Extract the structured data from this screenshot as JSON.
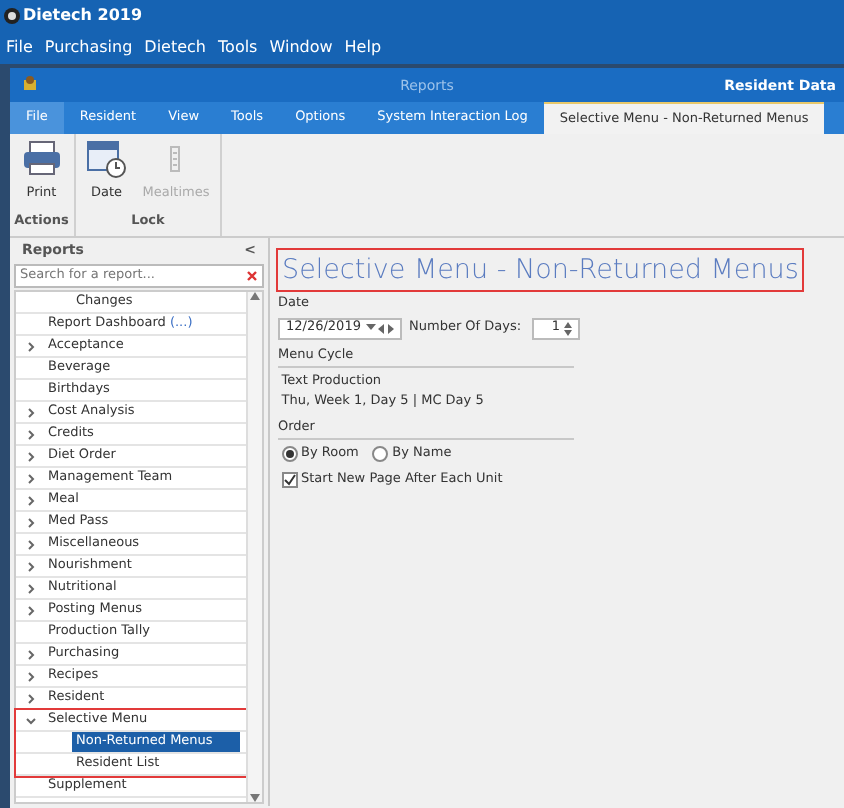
{
  "app": {
    "title": "Dietech 2019",
    "menu": [
      "File",
      "Purchasing",
      "Dietech",
      "Tools",
      "Window",
      "Help"
    ]
  },
  "window": {
    "title": "Reports",
    "right_title": "Resident Data"
  },
  "tabs": [
    {
      "label": "File",
      "kind": "file",
      "selected": false
    },
    {
      "label": "Resident",
      "kind": "tab",
      "selected": false
    },
    {
      "label": "View",
      "kind": "tab",
      "selected": false
    },
    {
      "label": "Tools",
      "kind": "tab",
      "selected": false
    },
    {
      "label": "Options",
      "kind": "tab",
      "selected": false
    },
    {
      "label": "System Interaction Log",
      "kind": "tab",
      "selected": false
    },
    {
      "label": "Selective Menu - Non-Returned Menus",
      "kind": "tab",
      "selected": true
    }
  ],
  "ribbon": [
    {
      "label": "Actions",
      "buttons": [
        {
          "label": "Print",
          "kind": "printer",
          "disabled": false
        }
      ]
    },
    {
      "label": "Lock",
      "buttons": [
        {
          "label": "Date",
          "kind": "calendar",
          "disabled": false
        },
        {
          "label": "Mealtimes",
          "kind": "clock",
          "disabled": true
        }
      ]
    }
  ],
  "sidebar": {
    "title": "Reports",
    "collapse": "<",
    "search": {
      "placeholder": "Search for a report..."
    },
    "tree": [
      {
        "label": "Changes",
        "kind": "orphan-child",
        "selected": false,
        "highlighted": false
      },
      {
        "label": "Report Dashboard",
        "suffix": "(...)",
        "selected": false,
        "highlighted": false
      },
      {
        "label": "Acceptance",
        "expandable": true,
        "expanded": false,
        "selected": false,
        "highlighted": false
      },
      {
        "label": "Beverage",
        "selected": false,
        "highlighted": false
      },
      {
        "label": "Birthdays",
        "selected": false,
        "highlighted": false
      },
      {
        "label": "Cost Analysis",
        "expandable": true,
        "expanded": false,
        "selected": false,
        "highlighted": false
      },
      {
        "label": "Credits",
        "expandable": true,
        "expanded": false,
        "selected": false,
        "highlighted": false
      },
      {
        "label": "Diet Order",
        "expandable": true,
        "expanded": false,
        "selected": false,
        "highlighted": false
      },
      {
        "label": "Management Team",
        "expandable": true,
        "expanded": false,
        "selected": false,
        "highlighted": false
      },
      {
        "label": "Meal",
        "expandable": true,
        "expanded": false,
        "selected": false,
        "highlighted": false
      },
      {
        "label": "Med Pass",
        "expandable": true,
        "expanded": false,
        "selected": false,
        "highlighted": false
      },
      {
        "label": "Miscellaneous",
        "expandable": true,
        "expanded": false,
        "selected": false,
        "highlighted": false
      },
      {
        "label": "Nourishment",
        "expandable": true,
        "expanded": false,
        "selected": false,
        "highlighted": false
      },
      {
        "label": "Nutritional",
        "expandable": true,
        "expanded": false,
        "selected": false,
        "highlighted": false
      },
      {
        "label": "Posting Menus",
        "expandable": true,
        "expanded": false,
        "selected": false,
        "highlighted": false
      },
      {
        "label": "Production Tally",
        "selected": false,
        "highlighted": false
      },
      {
        "label": "Purchasing",
        "expandable": true,
        "expanded": false,
        "selected": false,
        "highlighted": false
      },
      {
        "label": "Recipes",
        "expandable": true,
        "expanded": false,
        "selected": false,
        "highlighted": false
      },
      {
        "label": "Resident",
        "expandable": true,
        "expanded": false,
        "selected": false,
        "highlighted": false
      },
      {
        "label": "Selective Menu",
        "expandable": true,
        "expanded": true,
        "selected": false,
        "highlighted": true,
        "children": [
          {
            "label": "Non-Returned Menus",
            "selected": true
          },
          {
            "label": "Resident List",
            "selected": false
          }
        ]
      },
      {
        "label": "Supplement",
        "selected": false,
        "highlighted": false
      }
    ]
  },
  "content": {
    "title": "Selective Menu - Non-Returned Menus",
    "title_highlighted": true,
    "date_label": "Date",
    "date_value": "12/26/2019",
    "days_label": "Number Of Days:",
    "days_value": "1",
    "menu_cycle_label": "Menu Cycle",
    "menu_cycle_lines": [
      "Text Production",
      "Thu, Week 1, Day 5 | MC Day 5"
    ],
    "order_label": "Order",
    "order_options": [
      {
        "label": "By Room",
        "selected": true
      },
      {
        "label": "By Name",
        "selected": false
      }
    ],
    "new_page": {
      "label": "Start New Page After Each Unit",
      "checked": true
    }
  }
}
